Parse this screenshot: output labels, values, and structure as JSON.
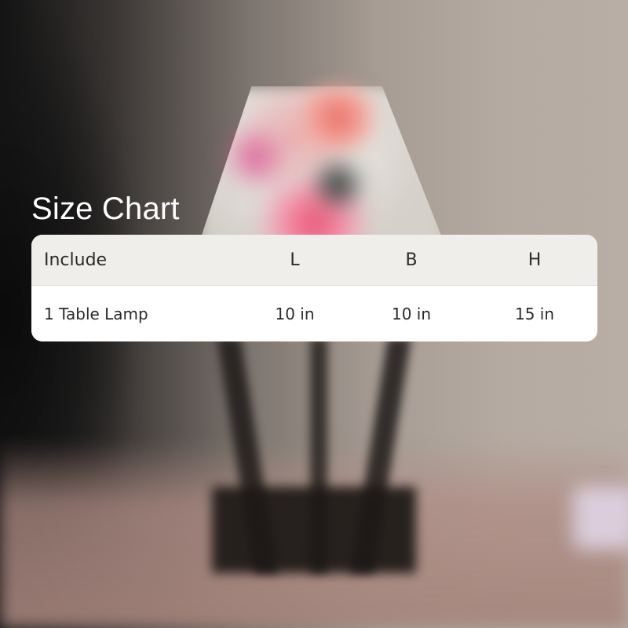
{
  "title": "Size Chart",
  "table": {
    "headers": [
      "Include",
      "L",
      "B",
      "H"
    ],
    "rows": [
      [
        "1 Table Lamp",
        "10 in",
        "10 in",
        "15 in"
      ]
    ]
  }
}
